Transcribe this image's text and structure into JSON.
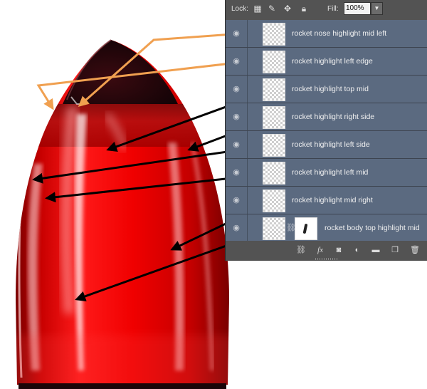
{
  "toolbar": {
    "lock_label": "Lock:",
    "fill_label": "Fill:",
    "fill_value": "100%"
  },
  "layers": [
    {
      "name": "rocket nose highlight mid left"
    },
    {
      "name": "rocket highlight left edge"
    },
    {
      "name": "rocket highlight top mid"
    },
    {
      "name": "rocket highlight right side"
    },
    {
      "name": "rocket highlight left side"
    },
    {
      "name": "rocket highlight left mid"
    },
    {
      "name": "rocket highlight mid right"
    },
    {
      "name": "rocket body top highlight mid",
      "has_mask": true
    }
  ],
  "colors": {
    "panel_bg": "#535353",
    "layer_selected": "#5b6a80",
    "rocket_red": "#e00000",
    "rocket_nose": "#1a0508",
    "arrow_orange": "#f0a050",
    "arrow_black": "#000000"
  }
}
